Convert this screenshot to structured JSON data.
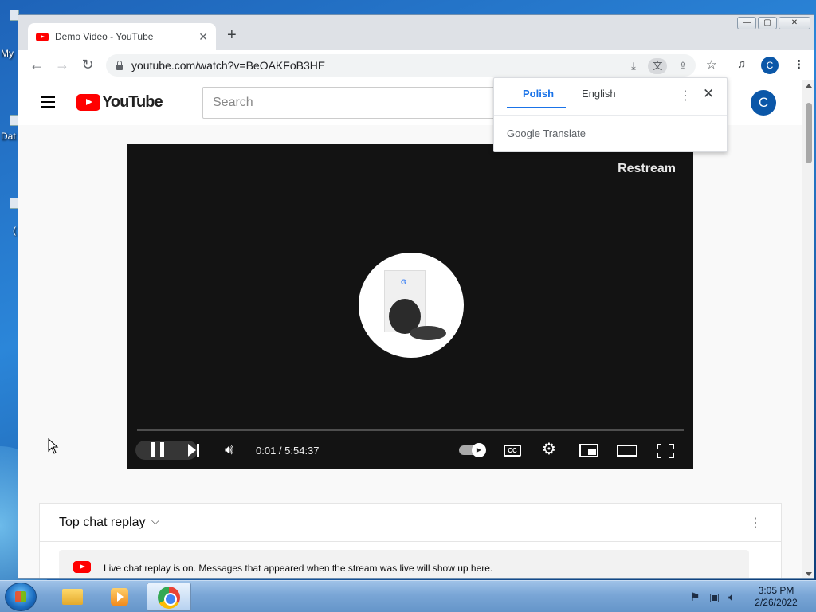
{
  "desktop": {
    "icon_labels": [
      "My",
      "Dat",
      "("
    ]
  },
  "window": {
    "tab_title": "Demo Video - YouTube",
    "tab_close": "✕",
    "new_tab": "+",
    "minimize": "—",
    "maximize": "▢",
    "close": "✕"
  },
  "toolbar": {
    "back": "←",
    "forward": "→",
    "reload": "↻",
    "url": "youtube.com/watch?v=BeOAKFoB3HE",
    "profile_initial": "C"
  },
  "youtube": {
    "logo_text": "YouTube",
    "search_placeholder": "Search",
    "avatar_initial": "C"
  },
  "player": {
    "watermark": "Restream",
    "time": "0:01 / 5:54:37",
    "progress_fraction": 0.0,
    "cc_label": "CC"
  },
  "chat": {
    "title": "Top chat replay",
    "chevron": "⌵",
    "more": "⋮",
    "notice": "Live chat replay is on. Messages that appeared when the stream was live will show up here."
  },
  "translate_popup": {
    "languages": [
      "Polish",
      "English"
    ],
    "active_language": "Polish",
    "more": "⋮",
    "close": "✕",
    "brand_google": "Google",
    "brand_translate": "Translate"
  },
  "taskbar": {
    "time": "3:05 PM",
    "date": "2/26/2022"
  },
  "colors": {
    "youtube_red": "#ff0000",
    "chrome_blue": "#1a73e8",
    "avatar_blue": "#0b57a8"
  }
}
